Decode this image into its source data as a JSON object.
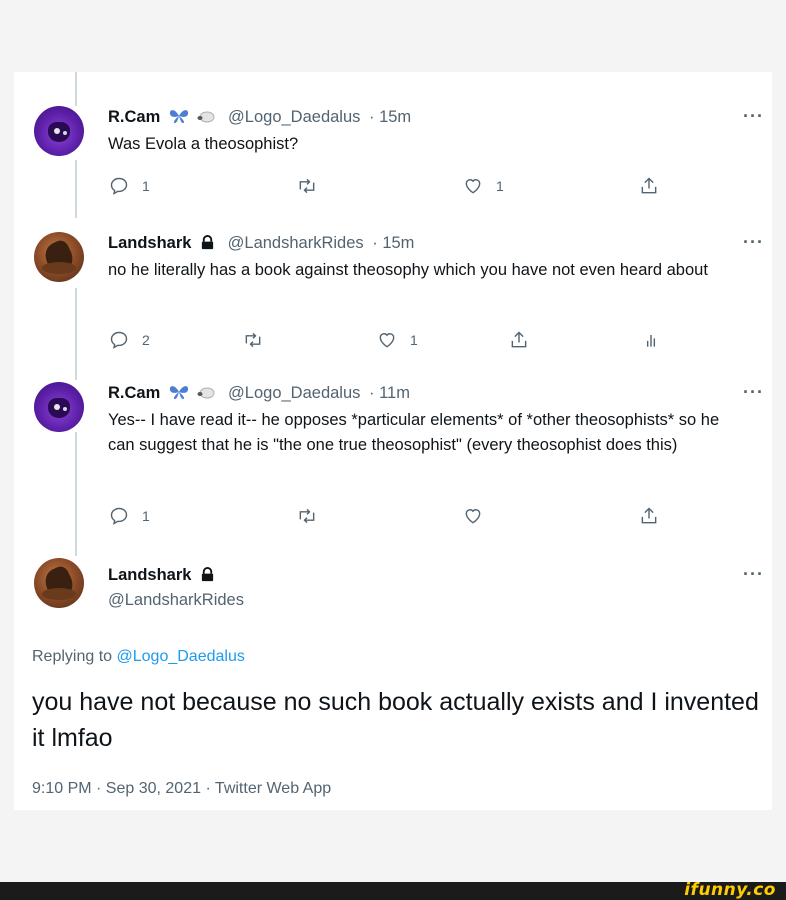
{
  "tweets": [
    {
      "name": "R.Cam",
      "handle": "@Logo_Daedalus",
      "time": "· 15m",
      "text": "Was Evola a theosophist?",
      "replies": "1",
      "retweets": "",
      "likes": "1"
    },
    {
      "name": "Landshark",
      "handle": "@LandsharkRides",
      "time": "· 15m",
      "text": "no he literally has a book against theosophy which you have not even heard about",
      "replies": "2",
      "retweets": "",
      "likes": "1"
    },
    {
      "name": "R.Cam",
      "handle": "@Logo_Daedalus",
      "time": "· 11m",
      "text": "Yes-- I have read it-- he opposes *particular elements* of *other theosophists* so he can suggest that he is \"the one true theosophist\" (every theosophist does this)",
      "replies": "1",
      "retweets": "",
      "likes": ""
    }
  ],
  "main_tweet": {
    "name": "Landshark",
    "handle": "@LandsharkRides",
    "replying_prefix": "Replying to",
    "replying_to": "@Logo_Daedalus",
    "text": "you have not because no such book actually exists and I invented it lmfao",
    "meta": "9:10 PM · Sep 30, 2021 · Twitter Web App"
  },
  "more_label": "···",
  "watermark": "ifunny.co",
  "colors": {
    "accent": "#1d9bf0",
    "secondary_text": "#536471",
    "primary_text": "#0f1419"
  }
}
